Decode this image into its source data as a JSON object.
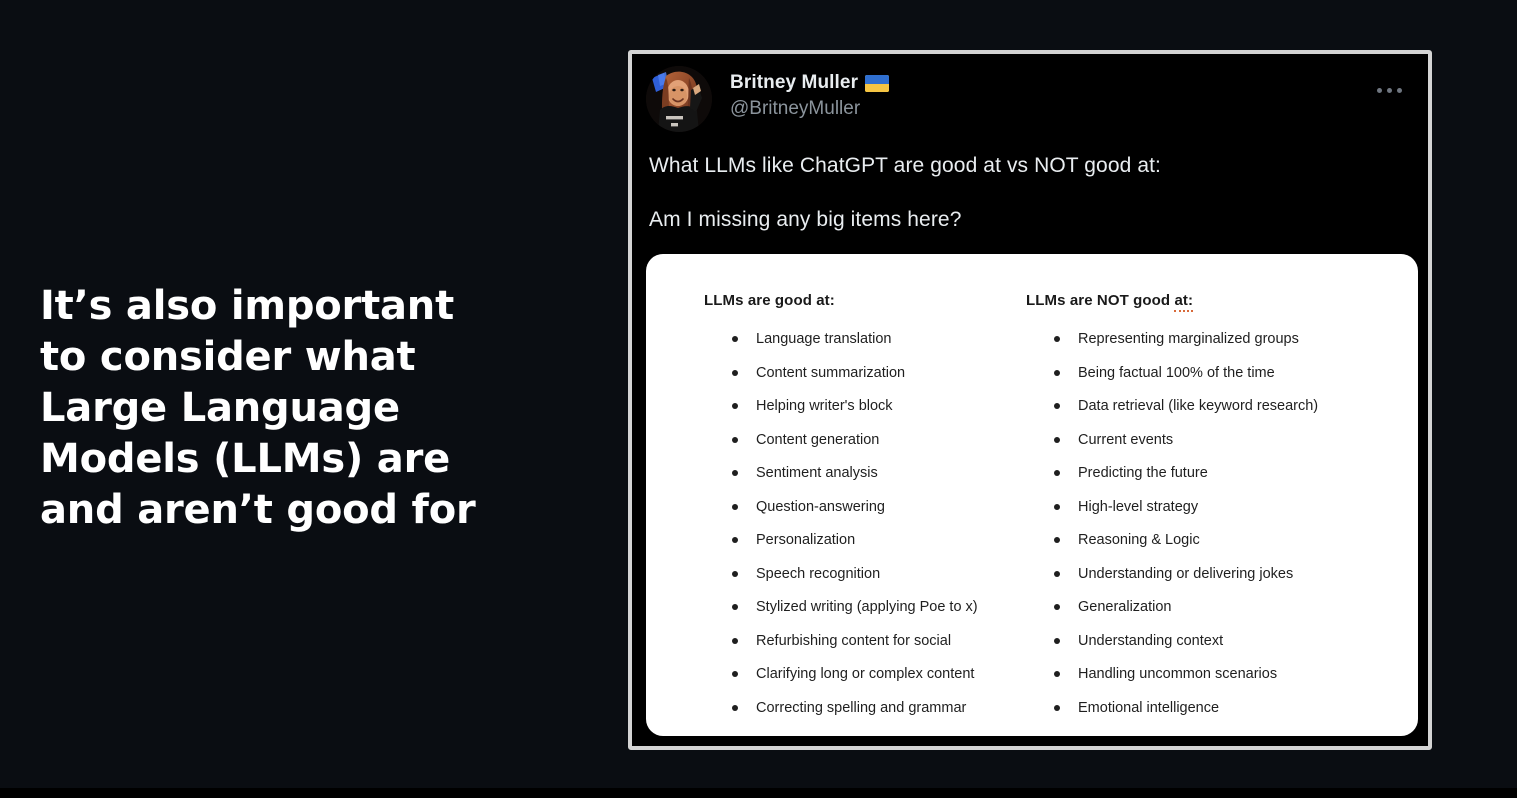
{
  "slide": {
    "background_color": "#0a0d12",
    "headline": "It’s also important\nto consider what\nLarge Language\nModels (LLMs) are\nand aren’t good for",
    "headline_color": "#ffffff"
  },
  "tweet": {
    "border_color": "#d4d4d4",
    "display_name": "Britney Muller",
    "flag_emoji": "🇺🇦",
    "flag_name": "ukraine-flag-emoji",
    "handle": "@BritneyMuller",
    "more_menu_label": "•••",
    "more_menu_icon": "more-horizontal-icon",
    "avatar_alt": "Britney Muller profile photo",
    "body_lines": [
      "What LLMs like ChatGPT are good at vs NOT good at:",
      "Am I missing any big items here?"
    ]
  },
  "embed": {
    "background_color": "#ffffff",
    "columns": [
      {
        "id": "llms-good-at",
        "heading": "LLMs are good at:",
        "heading_plain": "LLMs are good ",
        "heading_misspelled": "at:",
        "misspelled": false,
        "items": [
          "Language translation",
          "Content summarization",
          "Helping writer's block",
          "Content generation",
          "Sentiment analysis",
          "Question-answering",
          "Personalization",
          "Speech recognition",
          "Stylized writing (applying Poe to x)",
          "Refurbishing content for social",
          "Clarifying long or complex content",
          "Correcting spelling and grammar"
        ]
      },
      {
        "id": "llms-not-good-at",
        "heading": "LLMs are NOT good at:",
        "heading_plain": "LLMs are NOT good ",
        "heading_misspelled": "at:",
        "misspelled": true,
        "misspell_underline_color": "#d86a3a",
        "items": [
          "Representing marginalized groups",
          "Being factual 100% of the time",
          "Data retrieval (like keyword research)",
          "Current events",
          "Predicting the future",
          "High-level strategy",
          "Reasoning & Logic",
          "Understanding or delivering jokes",
          "Generalization",
          "Understanding context",
          "Handling uncommon scenarios",
          "Emotional intelligence"
        ]
      }
    ]
  }
}
